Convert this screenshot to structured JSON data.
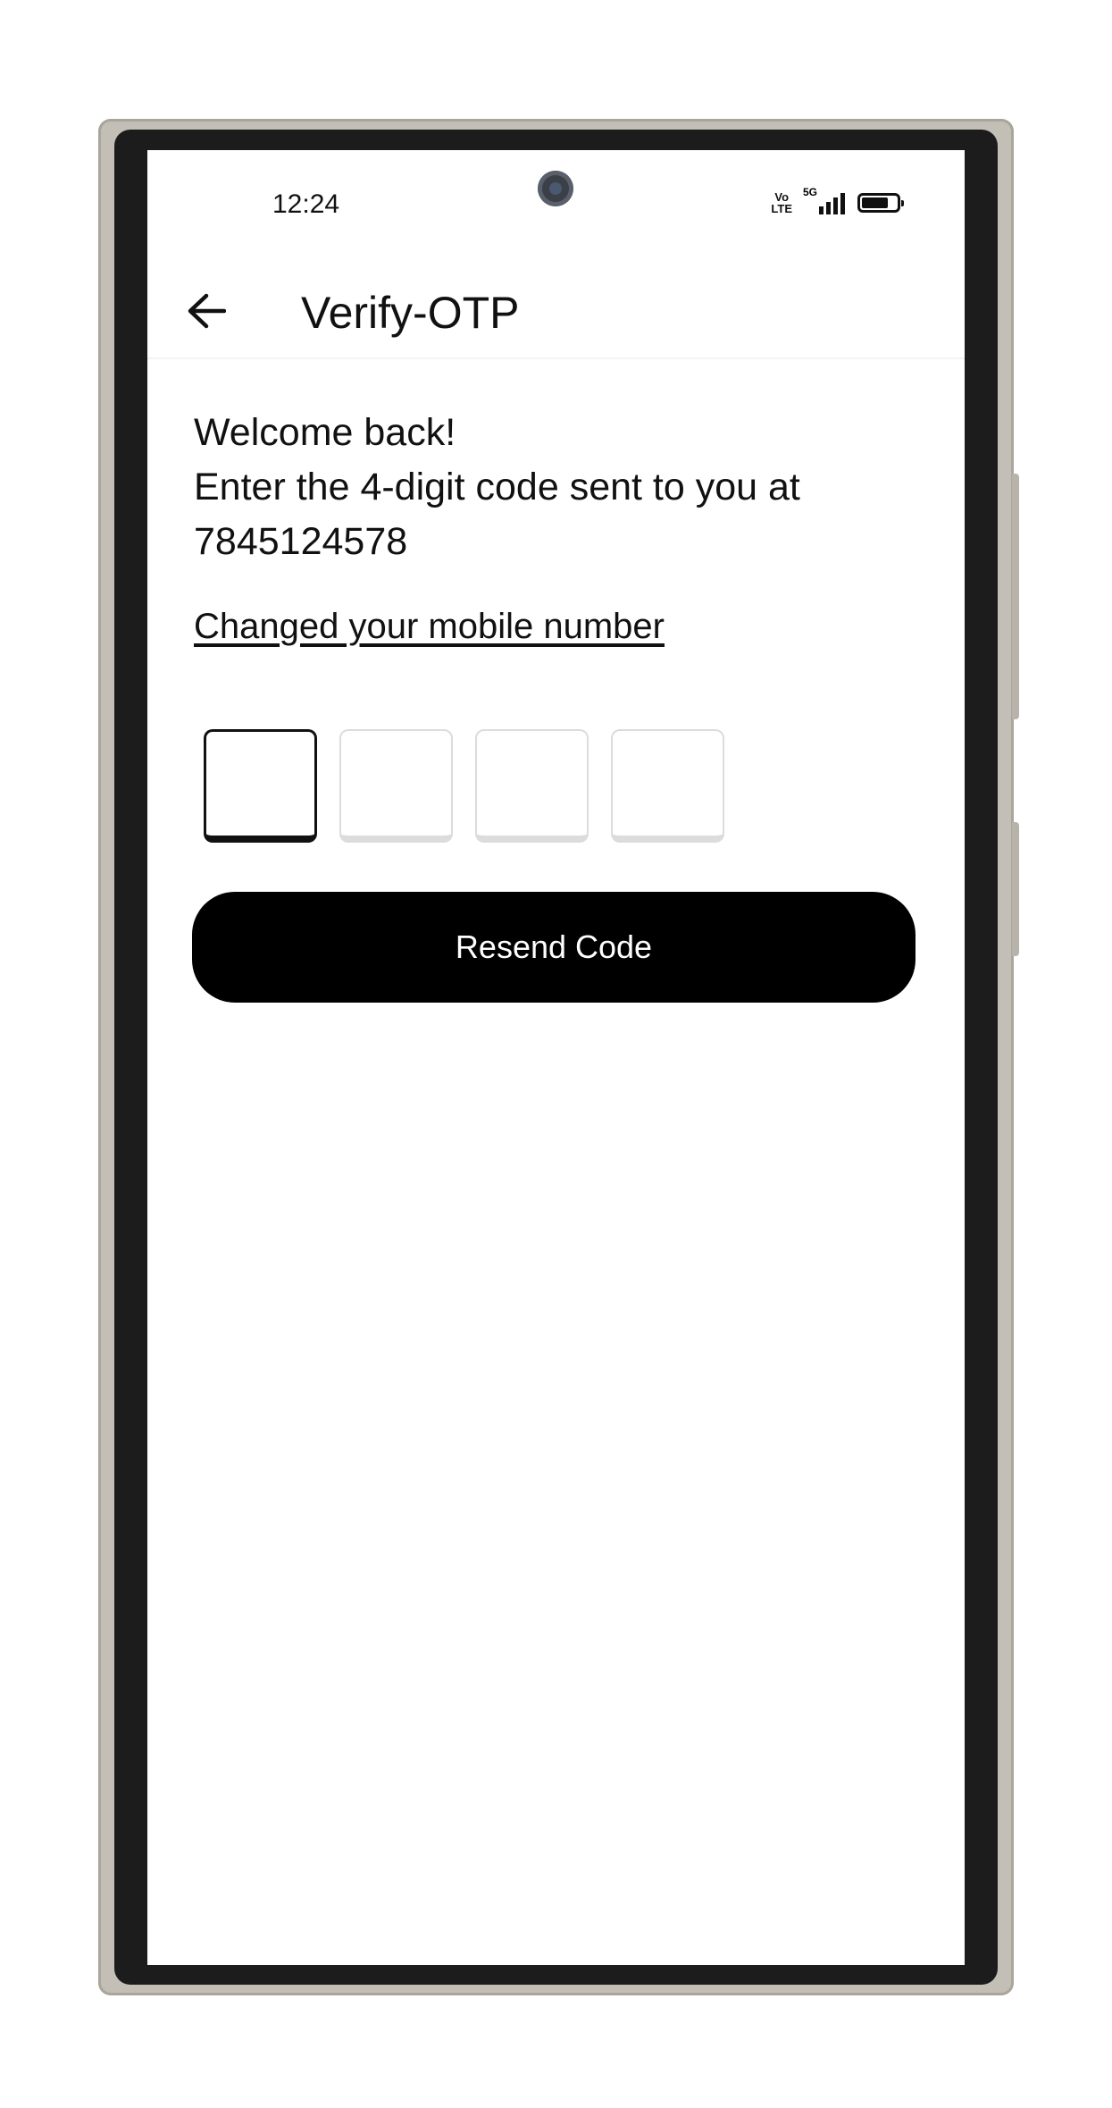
{
  "status_bar": {
    "time": "12:24",
    "volte_top": "Vo",
    "volte_bottom": "LTE",
    "network": "5G",
    "icons": [
      "volte-icon",
      "signal-icon",
      "battery-icon"
    ]
  },
  "app_bar": {
    "back_icon": "arrow-left-icon",
    "title": "Verify-OTP"
  },
  "main": {
    "welcome_line1": "Welcome back!",
    "welcome_line2": "Enter the 4-digit code sent to you at",
    "phone_number": "7845124578",
    "change_link": "Changed your mobile number",
    "otp_digits": [
      "",
      "",
      "",
      ""
    ],
    "resend_label": "Resend Code"
  },
  "colors": {
    "primary": "#000000",
    "background": "#ffffff",
    "inactive_box": "#dcdcdc"
  }
}
